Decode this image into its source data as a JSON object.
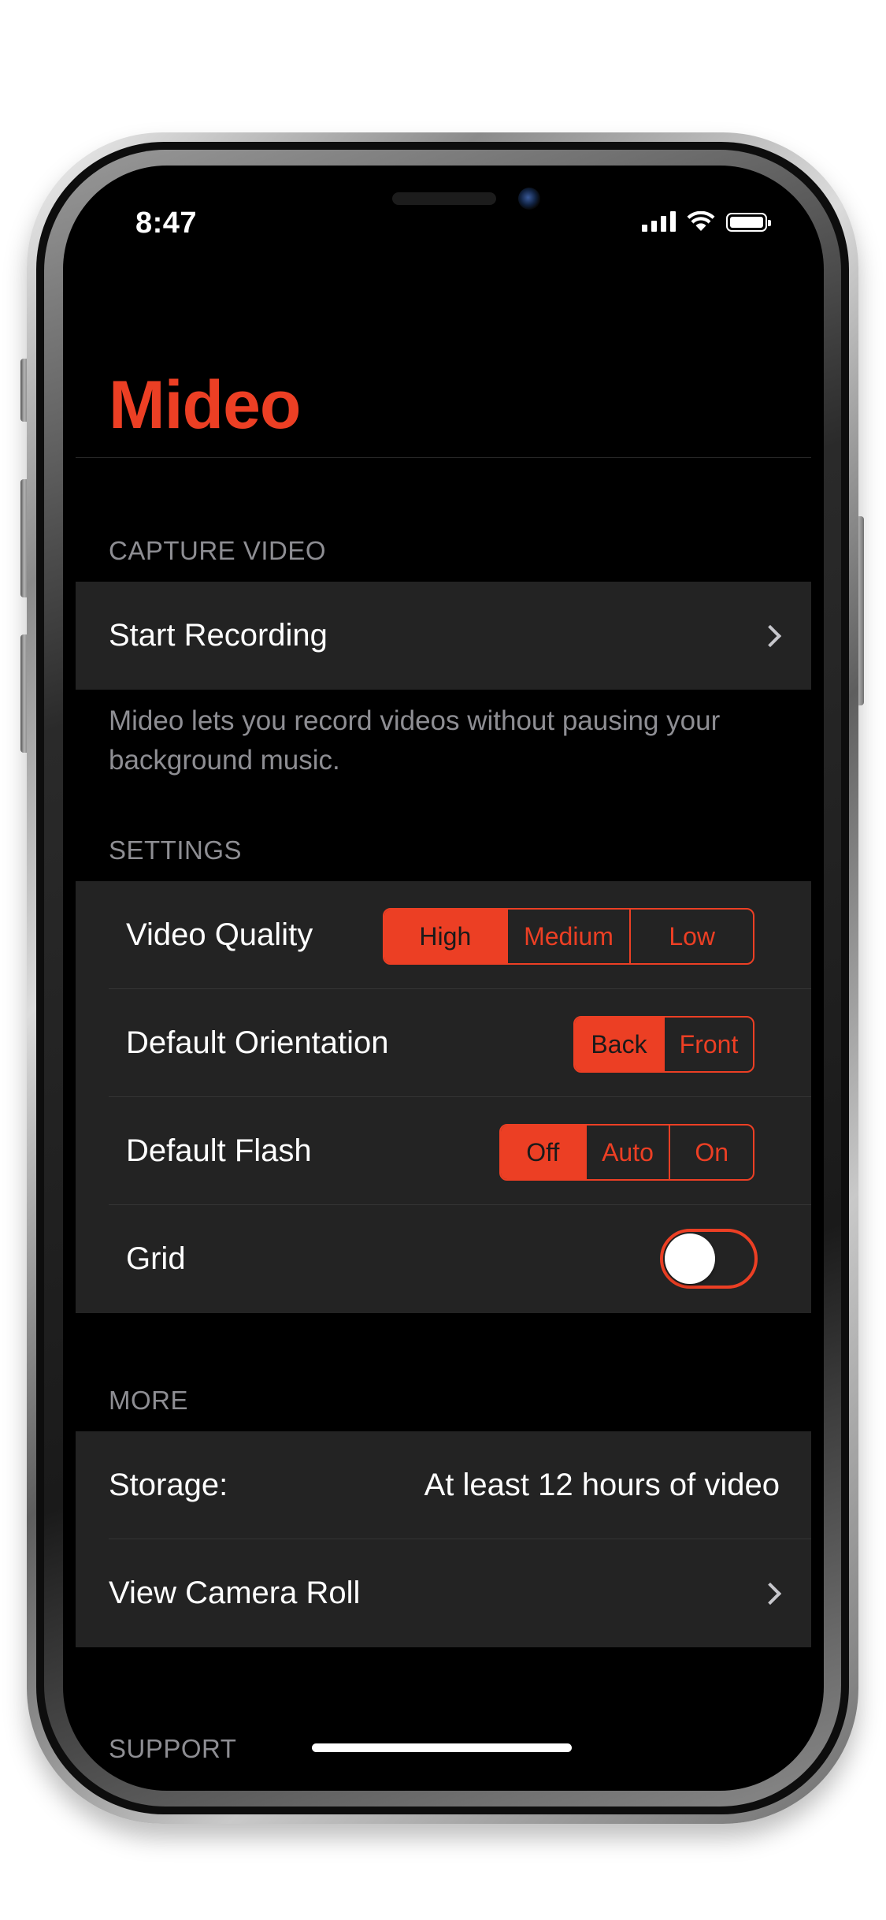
{
  "status_bar": {
    "time": "8:47"
  },
  "app": {
    "title": "Mideo",
    "accent_color": "#ec3f24"
  },
  "capture": {
    "header": "CAPTURE VIDEO",
    "start_recording_label": "Start Recording",
    "footer": "Mideo lets you record videos without pausing your background music."
  },
  "settings": {
    "header": "SETTINGS",
    "video_quality": {
      "label": "Video Quality",
      "options": [
        "High",
        "Medium",
        "Low"
      ],
      "selected": "High"
    },
    "default_orientation": {
      "label": "Default Orientation",
      "options": [
        "Back",
        "Front"
      ],
      "selected": "Back"
    },
    "default_flash": {
      "label": "Default Flash",
      "options": [
        "Off",
        "Auto",
        "On"
      ],
      "selected": "Off"
    },
    "grid": {
      "label": "Grid",
      "enabled": false
    }
  },
  "more": {
    "header": "MORE",
    "storage_label": "Storage:",
    "storage_value": "At least 12 hours of video",
    "camera_roll_label": "View Camera Roll"
  },
  "support": {
    "header": "SUPPORT"
  }
}
